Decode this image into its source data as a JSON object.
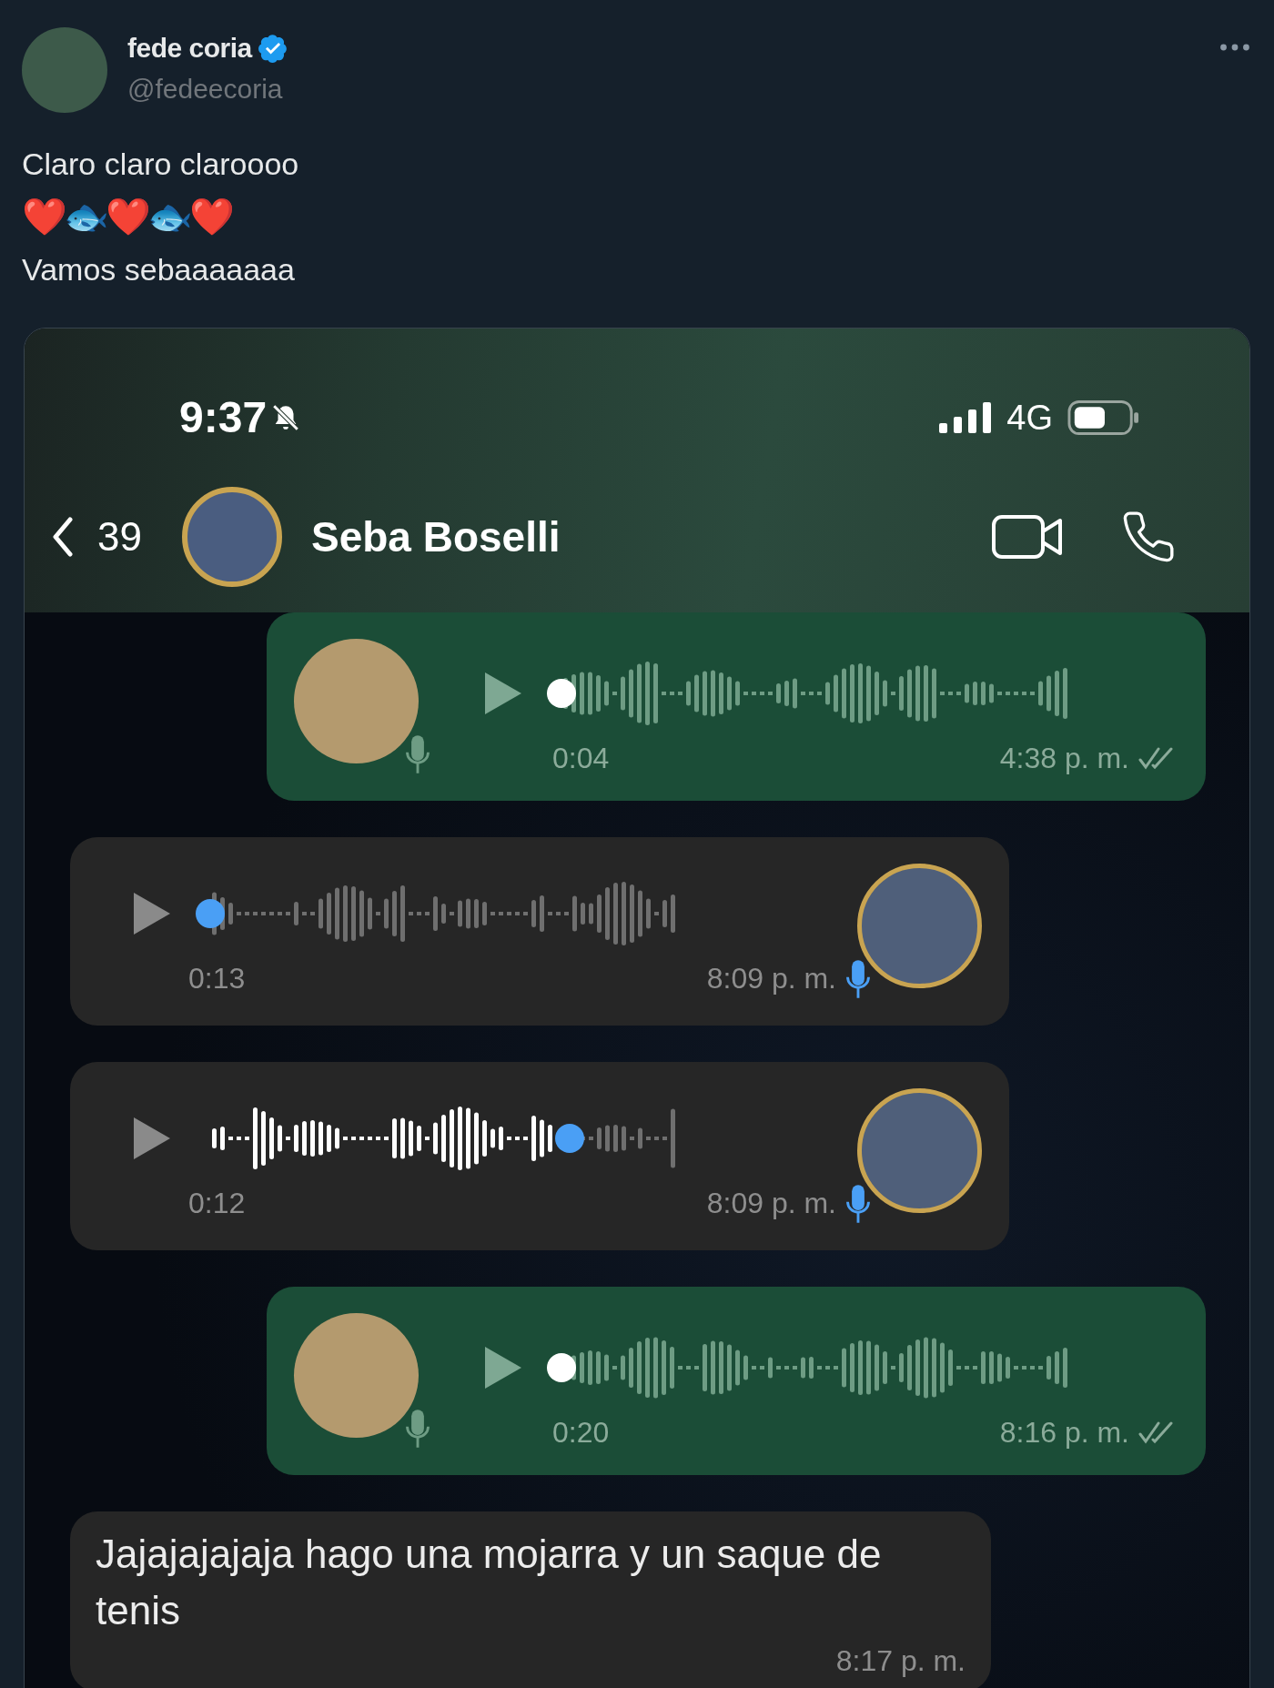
{
  "tweet": {
    "author": {
      "name": "fede coria",
      "handle": "@fedeecoria",
      "verified": true
    },
    "text_lines": [
      "Claro claro claroooo",
      "Vamos sebaaaaaaa"
    ],
    "emoji_line": "❤️🐟❤️🐟❤️"
  },
  "phone": {
    "status_bar": {
      "time": "9:37",
      "network": "4G"
    },
    "chat_header": {
      "back_count": "39",
      "contact": "Seba Boselli"
    },
    "messages": [
      {
        "kind": "voice",
        "outgoing": true,
        "duration": "0:04",
        "time": "4:38 p. m.",
        "level": 0
      },
      {
        "kind": "voice",
        "outgoing": false,
        "duration": "0:13",
        "time": "8:09 p. m.",
        "level": 0
      },
      {
        "kind": "voice",
        "outgoing": false,
        "duration": "0:12",
        "time": "8:09 p. m.",
        "level": 0.76
      },
      {
        "kind": "voice",
        "outgoing": true,
        "duration": "0:20",
        "time": "8:16 p. m.",
        "level": 0
      },
      {
        "kind": "text",
        "outgoing": false,
        "text": "Jajajajajaja hago una mojarra y un saque de tenis",
        "time": "8:17 p. m."
      }
    ]
  }
}
